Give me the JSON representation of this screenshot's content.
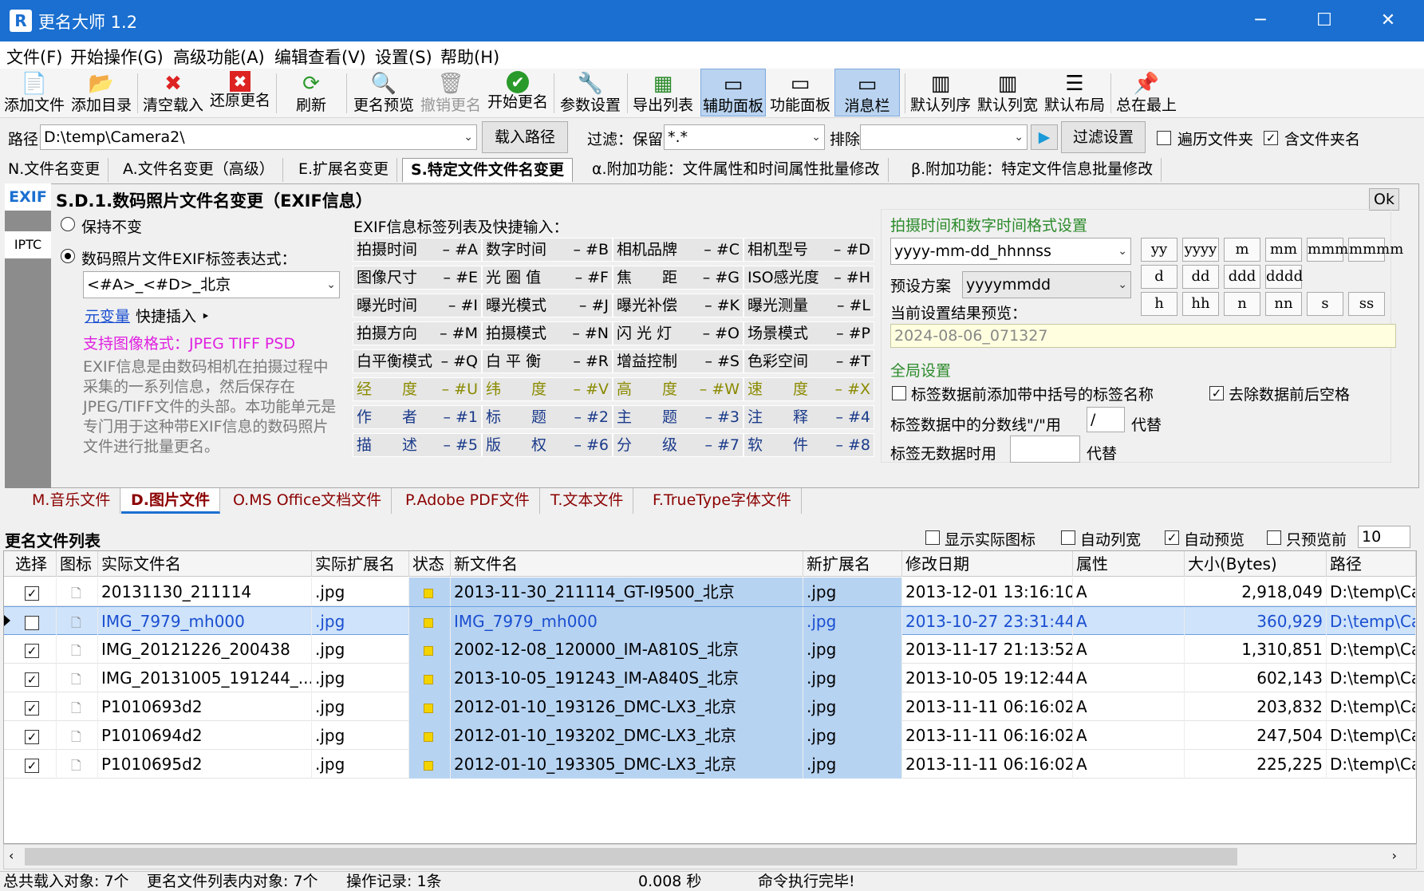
{
  "window": {
    "title": "更名大师 1.2",
    "min": "─",
    "max": "☐",
    "close": "✕"
  },
  "menu": [
    "文件(F)",
    "开始操作(G)",
    "高级功能(A)",
    "编辑查看(V)",
    "设置(S)",
    "帮助(H)"
  ],
  "toolbar": [
    {
      "label": "添加文件",
      "icon": "📄"
    },
    {
      "label": "添加目录",
      "icon": "📂"
    },
    {
      "label": "清空载入",
      "icon": "✖"
    },
    {
      "label": "还原更名",
      "icon": "✖"
    },
    {
      "label": "刷新",
      "icon": "⟳"
    },
    {
      "label": "更名预览",
      "icon": "🔍"
    },
    {
      "label": "撤销更名",
      "icon": "🗑"
    },
    {
      "label": "开始更名",
      "icon": "✔"
    },
    {
      "label": "参数设置",
      "icon": "🔧"
    },
    {
      "label": "导出列表",
      "icon": "▦"
    },
    {
      "label": "辅助面板",
      "icon": "▭"
    },
    {
      "label": "功能面板",
      "icon": "▭"
    },
    {
      "label": "消息栏",
      "icon": "▭"
    },
    {
      "label": "默认列序",
      "icon": "▥"
    },
    {
      "label": "默认列宽",
      "icon": "▥"
    },
    {
      "label": "默认布局",
      "icon": "☰"
    },
    {
      "label": "总在最上",
      "icon": "📌"
    }
  ],
  "pathbar": {
    "path_label": "路径",
    "path_value": "D:\\temp\\Camera2\\",
    "load_button": "载入路径",
    "filter_label": "过滤：保留",
    "filter_value": "*.*",
    "exclude_label": "排除",
    "exclude_value": "",
    "play": "▶",
    "filter_settings": "过滤设置",
    "traverse": "遍历文件夹",
    "include_folders": "含文件夹名",
    "traverse_checked": "",
    "include_checked": "✓"
  },
  "tabs": [
    "N.文件名变更",
    "A.文件名变更（高级）",
    "E.扩展名变更",
    "S.特定文件文件名变更",
    "α.附加功能：文件属性和时间属性批量修改",
    "β.附加功能：特定文件信息批量修改"
  ],
  "panel": {
    "exif_badge": "EXIF",
    "iptc_badge": "IPTC",
    "heading": "S.D.1.数码照片文件名变更（EXIF信息）",
    "ok": "Ok",
    "keep": "保持不变",
    "expr_label": "数码照片文件EXIF标签表达式：",
    "expr_value": "<#A>_<#D>_北京",
    "meta_link": "元变量",
    "meta_rest": "快捷插入 ‣",
    "supported": "支持图像格式：JPEG TIFF PSD",
    "desc": "EXIF信息是由数码相机在拍摄过程中采集的一系列信息，然后保存在JPEG/TIFF文件的头部。本功能单元是专门用于这种带EXIF信息的数码照片文件进行批量更名。",
    "tags_title": "EXIF信息标签列表及快捷输入：",
    "tags": [
      [
        "拍摄时间",
        "#A"
      ],
      [
        "数字时间",
        "#B"
      ],
      [
        "相机品牌",
        "#C"
      ],
      [
        "相机型号",
        "#D"
      ],
      [
        "图像尺寸",
        "#E"
      ],
      [
        "光 圈 值",
        "#F"
      ],
      [
        "焦　　距",
        "#G"
      ],
      [
        "ISO感光度",
        "#H"
      ],
      [
        "曝光时间",
        "#I"
      ],
      [
        "曝光模式",
        "#J"
      ],
      [
        "曝光补偿",
        "#K"
      ],
      [
        "曝光测量",
        "#L"
      ],
      [
        "拍摄方向",
        "#M"
      ],
      [
        "拍摄模式",
        "#N"
      ],
      [
        "闪 光 灯",
        "#O"
      ],
      [
        "场景模式",
        "#P"
      ],
      [
        "白平衡模式",
        "#Q"
      ],
      [
        "白 平 衡",
        "#R"
      ],
      [
        "增益控制",
        "#S"
      ],
      [
        "色彩空间",
        "#T"
      ],
      [
        "经　　度",
        "#U"
      ],
      [
        "纬　　度",
        "#V"
      ],
      [
        "高　　度",
        "#W"
      ],
      [
        "速　　度",
        "#X"
      ],
      [
        "作　　者",
        "#1"
      ],
      [
        "标　　题",
        "#2"
      ],
      [
        "主　　题",
        "#3"
      ],
      [
        "注　　释",
        "#4"
      ],
      [
        "描　　述",
        "#5"
      ],
      [
        "版　　权",
        "#6"
      ],
      [
        "分　　级",
        "#7"
      ],
      [
        "软　　件",
        "#8"
      ]
    ],
    "time_title": "拍摄时间和数字时间格式设置",
    "time_format": "yyyy-mm-dd_hhnnss",
    "preset_label": "预设方案",
    "preset_value": "yyyymmdd",
    "preview_label": "当前设置结果预览：",
    "preview_value": "2024-08-06_071327",
    "fmt": [
      "yy",
      "yyyy",
      "m",
      "mm",
      "mmm",
      "mmmm",
      "d",
      "dd",
      "ddd",
      "dddd",
      "",
      "",
      "h",
      "hh",
      "n",
      "nn",
      "s",
      "ss"
    ],
    "global_title": "全局设置",
    "opt1": "标签数据前添加带中括号的标签名称",
    "opt1_checked": "",
    "opt2": "去除数据前后空格",
    "opt2_checked": "✓",
    "sep_label": "标签数据中的分数线\"/\"用",
    "sep_value": "/",
    "sep_suffix": "代替",
    "nodata_label": "标签无数据时用",
    "nodata_value": "",
    "nodata_suffix": "代替"
  },
  "subtabs": [
    "M.音乐文件",
    "D.图片文件",
    "O.MS Office文档文件",
    "P.Adobe PDF文件",
    "T.文本文件",
    "F.TrueType字体文件"
  ],
  "list": {
    "title": "更名文件列表",
    "show_icons": "显示实际图标",
    "auto_width": "自动列宽",
    "auto_preview": "自动预览",
    "only_preview": "只预览前",
    "only_preview_value": "10",
    "show_icons_checked": "",
    "auto_width_checked": "",
    "auto_preview_checked": "✓",
    "only_preview_checked": "",
    "columns": [
      "选择",
      "图标",
      "实际文件名",
      "实际扩展名",
      "状态",
      "新文件名",
      "新扩展名",
      "修改日期",
      "属性",
      "大小(Bytes)",
      "路径"
    ],
    "rows": [
      {
        "chk": "✓",
        "name": "20131130_211114",
        "ext": ".jpg",
        "newname": "2013-11-30_211114_GT-I9500_北京",
        "newext": ".jpg",
        "date": "2013-12-01 13:16:10",
        "attr": "A",
        "size": "2,918,049",
        "path": "D:\\temp\\Ca"
      },
      {
        "chk": "",
        "name": "IMG_7979_mh000",
        "ext": ".jpg",
        "newname": "IMG_7979_mh000",
        "newext": ".jpg",
        "date": "2013-10-27 23:31:44",
        "attr": "A",
        "size": "360,929",
        "path": "D:\\temp\\Ca"
      },
      {
        "chk": "✓",
        "name": "IMG_20121226_200438",
        "ext": ".jpg",
        "newname": "2002-12-08_120000_IM-A810S_北京",
        "newext": ".jpg",
        "date": "2013-11-17 21:13:52",
        "attr": "A",
        "size": "1,310,851",
        "path": "D:\\temp\\Ca"
      },
      {
        "chk": "✓",
        "name": "IMG_20131005_191244_...",
        "ext": ".jpg",
        "newname": "2013-10-05_191243_IM-A840S_北京",
        "newext": ".jpg",
        "date": "2013-10-05 19:12:44",
        "attr": "A",
        "size": "602,143",
        "path": "D:\\temp\\Ca"
      },
      {
        "chk": "✓",
        "name": "P1010693d2",
        "ext": ".jpg",
        "newname": "2012-01-10_193126_DMC-LX3_北京",
        "newext": ".jpg",
        "date": "2013-11-11 06:16:02",
        "attr": "A",
        "size": "203,832",
        "path": "D:\\temp\\Ca"
      },
      {
        "chk": "✓",
        "name": "P1010694d2",
        "ext": ".jpg",
        "newname": "2012-01-10_193202_DMC-LX3_北京",
        "newext": ".jpg",
        "date": "2013-11-11 06:16:02",
        "attr": "A",
        "size": "247,504",
        "path": "D:\\temp\\Ca"
      },
      {
        "chk": "✓",
        "name": "P1010695d2",
        "ext": ".jpg",
        "newname": "2012-01-10_193305_DMC-LX3_北京",
        "newext": ".jpg",
        "date": "2013-11-11 06:16:02",
        "attr": "A",
        "size": "225,225",
        "path": "D:\\temp\\Ca"
      }
    ]
  },
  "status": {
    "s1": "总共载入对象: 7个",
    "s2": "更名文件列表内对象: 7个",
    "s3": "操作记录: 1条",
    "s4": "0.008 秒",
    "s5": "命令执行完毕!"
  }
}
